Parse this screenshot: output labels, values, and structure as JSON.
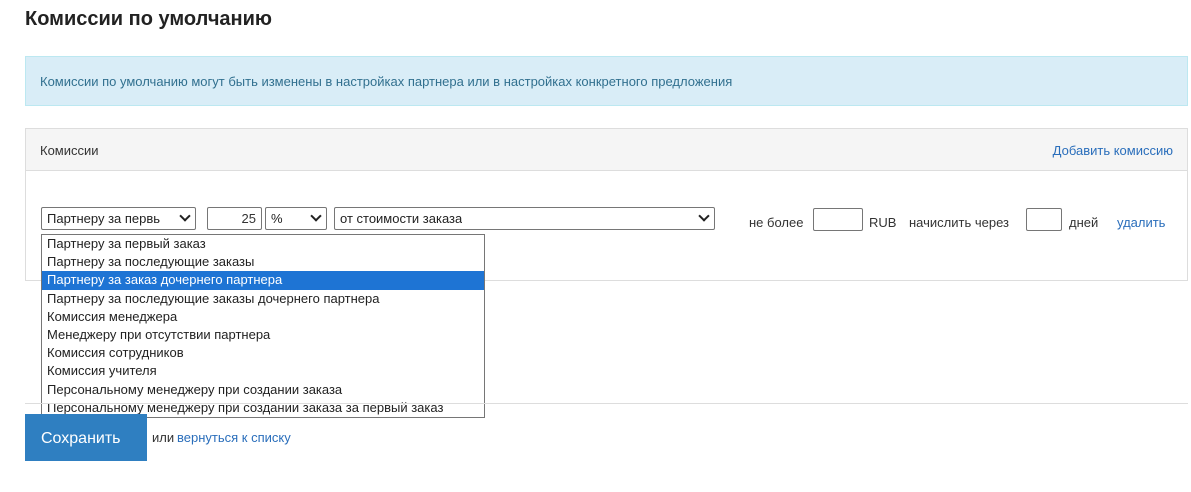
{
  "page": {
    "title": "Комиссии по умолчанию",
    "info": "Комиссии по умолчанию могут быть изменены в настройках партнера или в настройках конкретного предложения"
  },
  "panel": {
    "title": "Комиссии",
    "add_link": "Добавить комиссию"
  },
  "row": {
    "type_select_value": "Партнеру за первь",
    "amount": "25",
    "unit_select_value": "%",
    "base_select_value": "от стоимости заказа",
    "max_label": "не более",
    "max_value": "",
    "currency": "RUB",
    "delay_label": "начислить через",
    "delay_value": "",
    "days_label": "дней",
    "delete_link": "удалить"
  },
  "dropdown": {
    "selected_index": 2,
    "options": [
      "Партнеру за первый заказ",
      "Партнеру за последующие заказы",
      "Партнеру за заказ дочернего партнера",
      "Партнеру за последующие заказы дочернего партнера",
      "Комиссия менеджера",
      "Менеджеру при отсутствии партнера",
      "Комиссия сотрудников",
      "Комиссия учителя",
      "Персональному менеджеру при создании заказа",
      "Персональному менеджеру при создании заказа за первый заказ"
    ]
  },
  "footer": {
    "save_label": "Сохранить",
    "or_text": "или",
    "back_link": "вернуться к списку"
  },
  "colors": {
    "accent": "#2f7fc1",
    "link": "#2a6ebb",
    "info_bg": "#d9edf7",
    "selection": "#1e74d4"
  }
}
